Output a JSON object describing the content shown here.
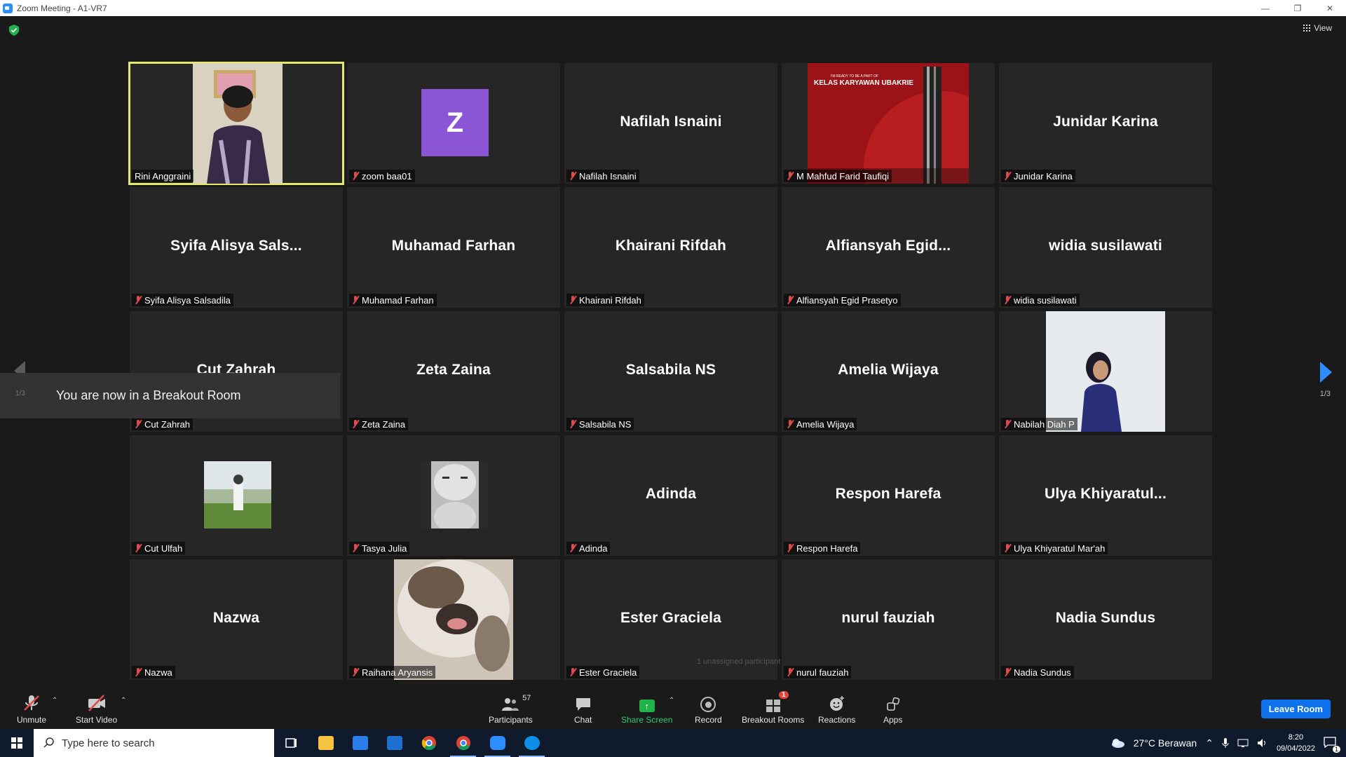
{
  "window": {
    "title": "Zoom Meeting - A1-VR7"
  },
  "top_bar": {
    "view_label": "View"
  },
  "tiles": [
    {
      "big": "",
      "label": "Rini Anggraini",
      "muted": false,
      "active": true,
      "kind": "video"
    },
    {
      "big": "",
      "label": "zoom baa01",
      "muted": true,
      "kind": "avatar",
      "avatar_letter": "Z"
    },
    {
      "big": "Nafilah Isnaini",
      "label": "Nafilah Isnaini",
      "muted": true
    },
    {
      "big": "",
      "label": "M Mahfud Farid Taufiqi",
      "muted": true,
      "kind": "banner",
      "banner_small": "I'M READY TO BE A PART OF",
      "banner_text": "KELAS KARYAWAN UBAKRIE"
    },
    {
      "big": "Junidar Karina",
      "label": "Junidar Karina",
      "muted": true
    },
    {
      "big": "Syifa  Alisya  Sals...",
      "label": "Syifa Alisya Salsadila",
      "muted": true
    },
    {
      "big": "Muhamad Farhan",
      "label": "Muhamad Farhan",
      "muted": true
    },
    {
      "big": "Khairani Rifdah",
      "label": "Khairani Rifdah",
      "muted": true
    },
    {
      "big": "Alfiansyah  Egid...",
      "label": "Alfiansyah Egid Prasetyo",
      "muted": true
    },
    {
      "big": "widia susilawati",
      "label": "widia susilawati",
      "muted": true
    },
    {
      "big": "Cut Zahrah",
      "label": "Cut Zahrah",
      "muted": true
    },
    {
      "big": "Zeta Zaina",
      "label": "Zeta Zaina",
      "muted": true
    },
    {
      "big": "Salsabila NS",
      "label": "Salsabila NS",
      "muted": true
    },
    {
      "big": "Amelia Wijaya",
      "label": "Amelia Wijaya",
      "muted": true
    },
    {
      "big": "",
      "label": "Nabilah Diah P",
      "muted": true,
      "kind": "photo"
    },
    {
      "big": "",
      "label": "Cut Ulfah",
      "muted": true,
      "kind": "thumb"
    },
    {
      "big": "",
      "label": "Tasya Julia",
      "muted": true,
      "kind": "thumb"
    },
    {
      "big": "Adinda",
      "label": "Adinda",
      "muted": true
    },
    {
      "big": "Respon Harefa",
      "label": "Respon Harefa",
      "muted": true
    },
    {
      "big": "Ulya  Khiyaratul...",
      "label": "Ulya Khiyaratul Mar'ah",
      "muted": true
    },
    {
      "big": "Nazwa",
      "label": "Nazwa",
      "muted": true
    },
    {
      "big": "",
      "label": "Raihana Aryansis",
      "muted": true,
      "kind": "photo"
    },
    {
      "big": "Ester Graciela",
      "label": "Ester Graciela",
      "muted": true
    },
    {
      "big": "nurul fauziah",
      "label": "nurul fauziah",
      "muted": true
    },
    {
      "big": "Nadia Sundus",
      "label": "Nadia Sundus",
      "muted": true
    }
  ],
  "toast": {
    "message": "You are now in a Breakout Room",
    "page": "1/3"
  },
  "pager": {
    "page": "1/3"
  },
  "unassigned": "1 unassigned participant",
  "toolbar": {
    "unmute": "Unmute",
    "start_video": "Start Video",
    "participants": "Participants",
    "participants_count": "57",
    "chat": "Chat",
    "share_screen": "Share Screen",
    "record": "Record",
    "breakout_rooms": "Breakout Rooms",
    "breakout_badge": "1",
    "reactions": "Reactions",
    "apps": "Apps",
    "leave": "Leave Room"
  },
  "taskbar": {
    "search_placeholder": "Type here to search",
    "weather": "27°C  Berawan",
    "time": "8:20",
    "date": "09/04/2022",
    "notification_count": "1"
  },
  "colors": {
    "accent": "#0e72ed",
    "active_speaker": "#e5e86a",
    "share": "#1fb44a",
    "mute": "#e04a4a"
  }
}
